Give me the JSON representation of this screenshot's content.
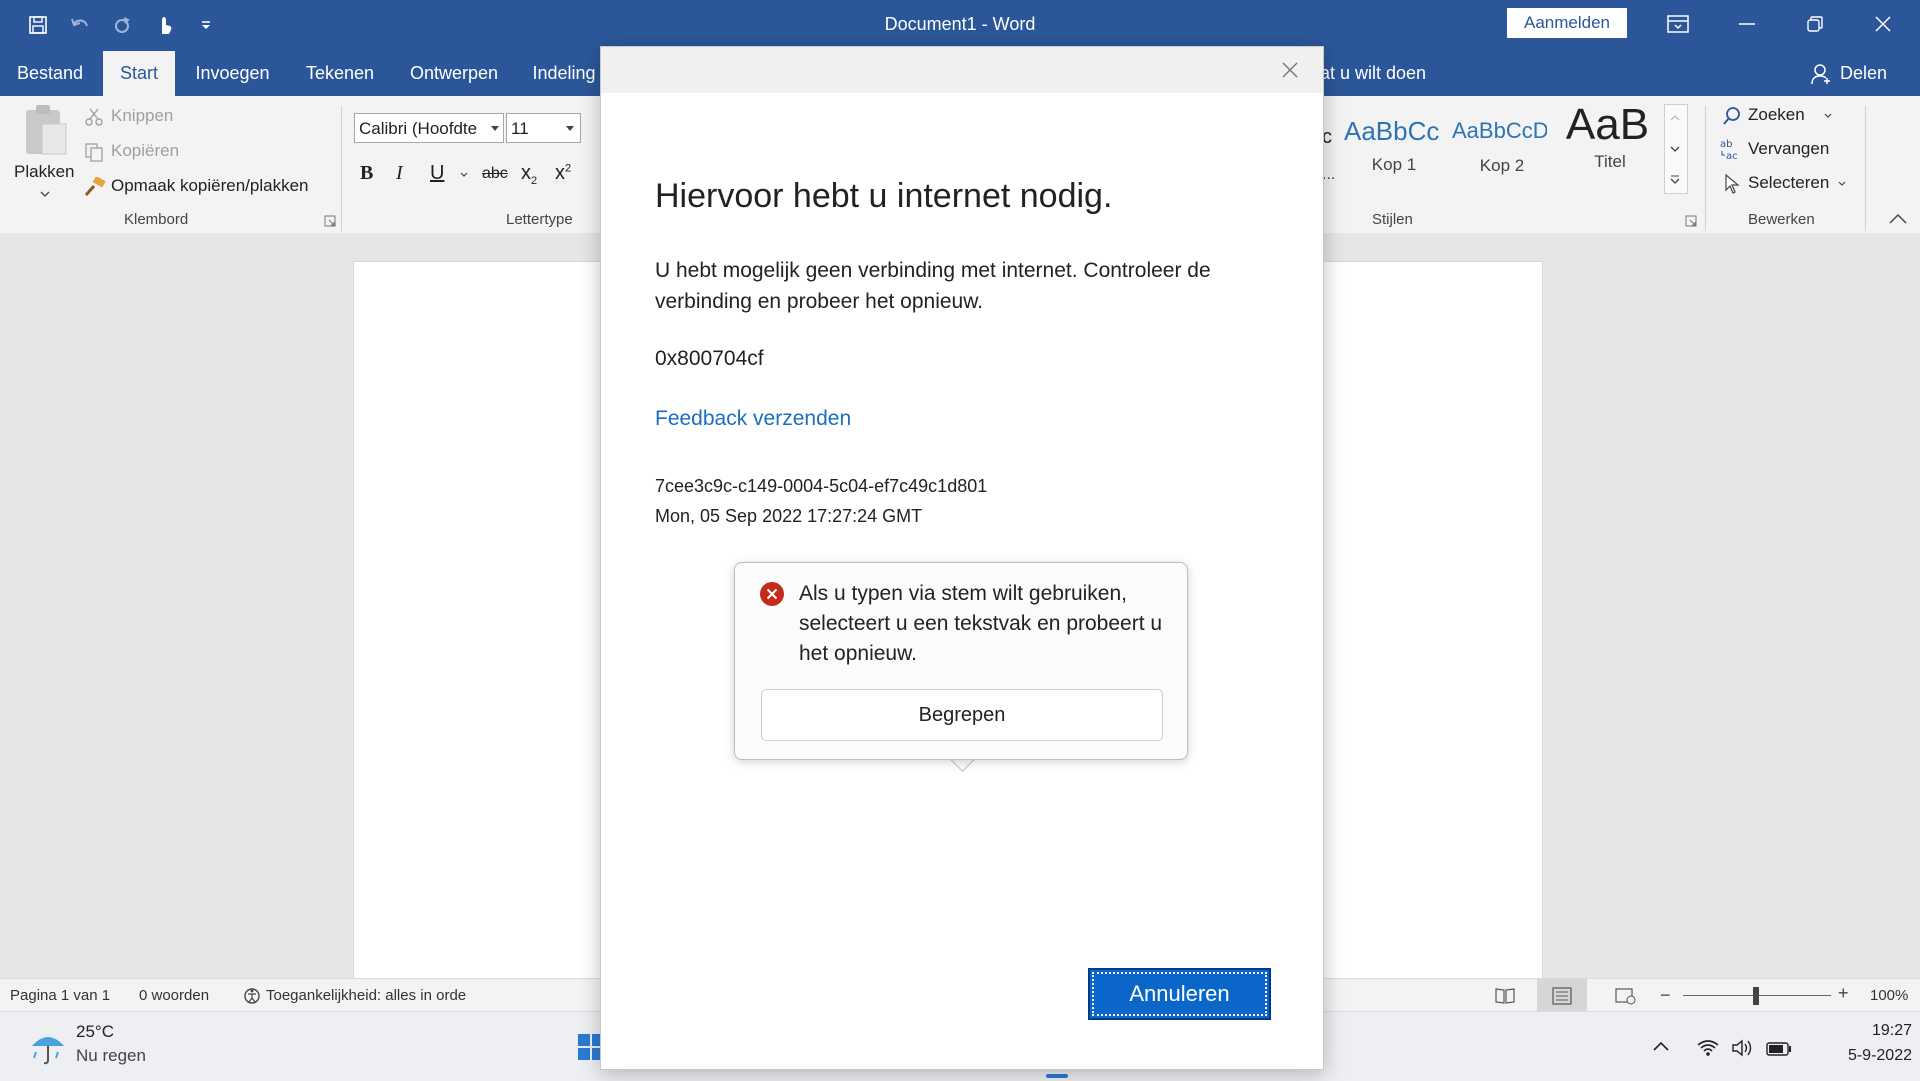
{
  "titlebar": {
    "title": "Document1  -  Word",
    "signin_label": "Aanmelden"
  },
  "tabs": {
    "items": [
      "Bestand",
      "Start",
      "Invoegen",
      "Tekenen",
      "Ontwerpen",
      "Indeling"
    ],
    "active": "Start",
    "tellme": "at u wilt doen",
    "share": "Delen"
  },
  "ribbon": {
    "clipboard": {
      "paste": "Plakken",
      "cut": "Knippen",
      "copy": "Kopiëren",
      "format_painter": "Opmaak kopiëren/plakken",
      "label": "Klembord"
    },
    "font": {
      "font_name": "Calibri (Hoofdte",
      "font_size": "11",
      "label": "Lettertype"
    },
    "styles": {
      "items": [
        {
          "preview": "c",
          "name": "..."
        },
        {
          "preview": "AaBbCc",
          "name": "Kop 1"
        },
        {
          "preview": "AaBbCcD",
          "name": "Kop 2"
        },
        {
          "preview": "AaB",
          "name": "Titel"
        }
      ],
      "label": "Stijlen"
    },
    "editing": {
      "find": "Zoeken",
      "replace": "Vervangen",
      "select": "Selecteren",
      "label": "Bewerken"
    }
  },
  "dialog": {
    "title": "Hiervoor hebt u internet nodig.",
    "body": "U hebt mogelijk geen verbinding met internet. Controleer de verbinding en probeer het opnieuw.",
    "error_code": "0x800704cf",
    "feedback_link": "Feedback verzenden",
    "session_id": "7cee3c9c-c149-0004-5c04-ef7c49c1d801",
    "timestamp": "Mon, 05 Sep 2022 17:27:24 GMT",
    "cancel_label": "Annuleren"
  },
  "popup": {
    "message": "Als u typen via stem wilt gebruiken, selecteert u een tekstvak en probeert u het opnieuw.",
    "button_label": "Begrepen"
  },
  "statusbar": {
    "page": "Pagina 1 van 1",
    "words": "0 woorden",
    "accessibility": "Toegankelijkheid: alles in orde",
    "zoom": "100%"
  },
  "taskbar": {
    "weather_temp": "25°C",
    "weather_desc": "Nu regen",
    "time": "19:27",
    "date": "5-9-2022"
  }
}
